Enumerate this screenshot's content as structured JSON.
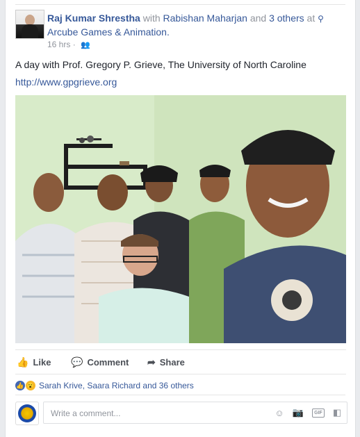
{
  "post": {
    "author": "Raj Kumar Shrestha",
    "with_word": "with",
    "tagged_user": "Rabishan Maharjan",
    "and_word": "and",
    "others_tagged": "3 others",
    "at_word": "at",
    "location": "Arcube Games & Animation.",
    "time": "16 hrs",
    "audience_icon": "friends-icon",
    "text": "A day with Prof. Gregory P. Grieve, The University of North Caroline",
    "link": "http://www.gpgrieve.org"
  },
  "actions": {
    "like": "Like",
    "comment": "Comment",
    "share": "Share"
  },
  "reactions": {
    "types": [
      "like",
      "wow"
    ],
    "summary": "Sarah Krive, Saara Richard and 36 others"
  },
  "comment_box": {
    "placeholder": "Write a comment..."
  },
  "colors": {
    "link_blue": "#365899",
    "like_blue": "#4267b2",
    "meta_gray": "#90949c"
  }
}
